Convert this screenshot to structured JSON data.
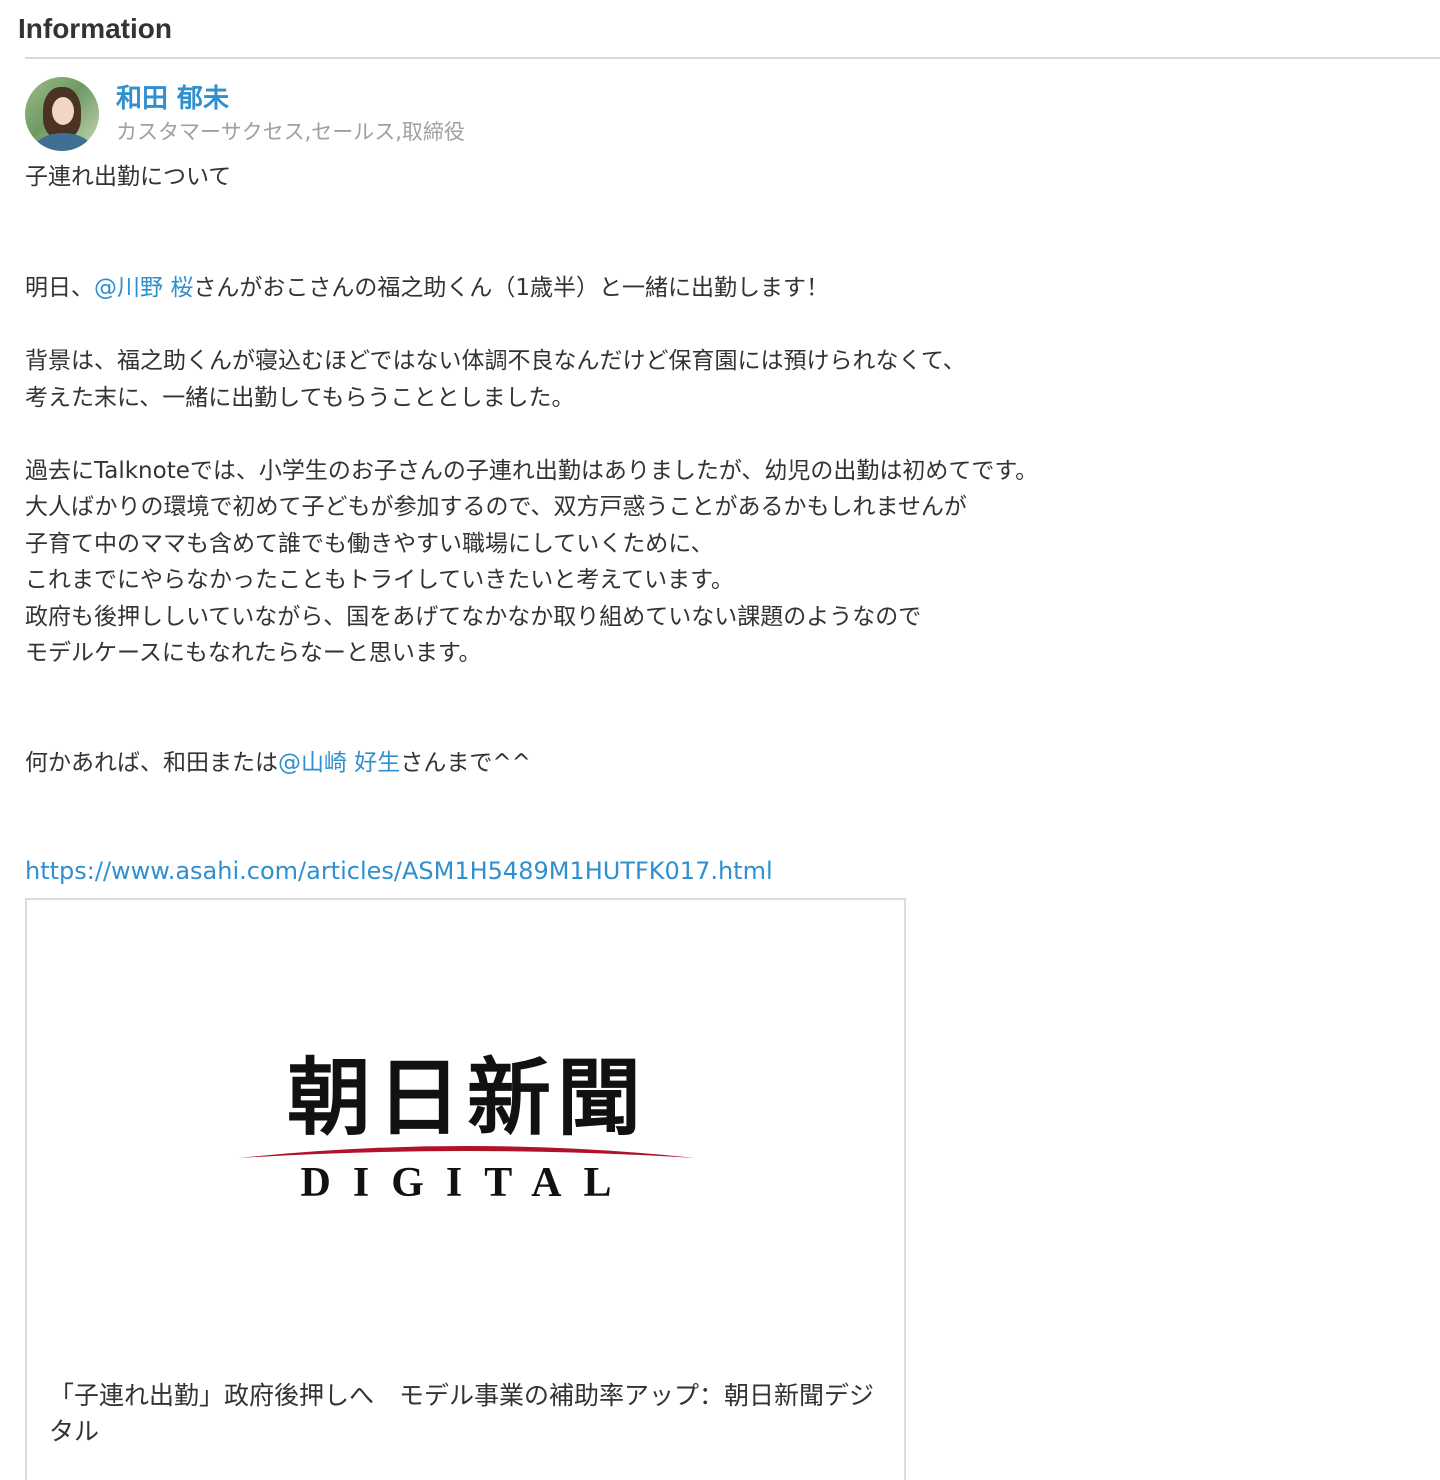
{
  "section": {
    "title": "Information"
  },
  "post": {
    "author": {
      "name": "和田 郁未",
      "role": "カスタマーサクセス,セールス,取締役",
      "avatar_icon": "user-avatar-photo"
    },
    "title": "子連れ出勤について",
    "body": {
      "line1": {
        "pre": "明日、",
        "mention": "@川野 桜",
        "post": "さんがおこさんの福之助くん（1歳半）と一緒に出勤します！"
      },
      "line2": "背景は、福之助くんが寝込むほどではない体調不良なんだけど保育園には預けられなくて、",
      "line3": "考えた末に、一緒に出勤してもらうこととしました。",
      "line4": "過去にTalknoteでは、小学生のお子さんの子連れ出勤はありましたが、幼児の出勤は初めてです。",
      "line5": "大人ばかりの環境で初めて子どもが参加するので、双方戸惑うことがあるかもしれませんが",
      "line6": "子育て中のママも含めて誰でも働きやすい職場にしていくために、",
      "line7": "これまでにやらなかったこともトライしていきたいと考えています。",
      "line8": "政府も後押ししいていながら、国をあげてなかなか取り組めていない課題のようなので",
      "line9": "モデルケースにもなれたらなーと思います。",
      "line10": {
        "pre": "何かあれば、和田または",
        "mention": "@山崎 好生",
        "post": "さんまで^^"
      }
    },
    "link": "https://www.asahi.com/articles/ASM1H5489M1HUTFK017.html",
    "preview": {
      "logo_kanji": "朝日新聞",
      "logo_sub": "DIGITAL",
      "logo_accent": "#b0122a",
      "title": "「子連れ出勤」政府後押しへ　モデル事業の補助率アップ：朝日新聞デジタル"
    }
  },
  "colors": {
    "link": "#2f8fcf",
    "text": "#333333",
    "muted": "#a0a0a0",
    "rule": "#d4d9e2"
  }
}
